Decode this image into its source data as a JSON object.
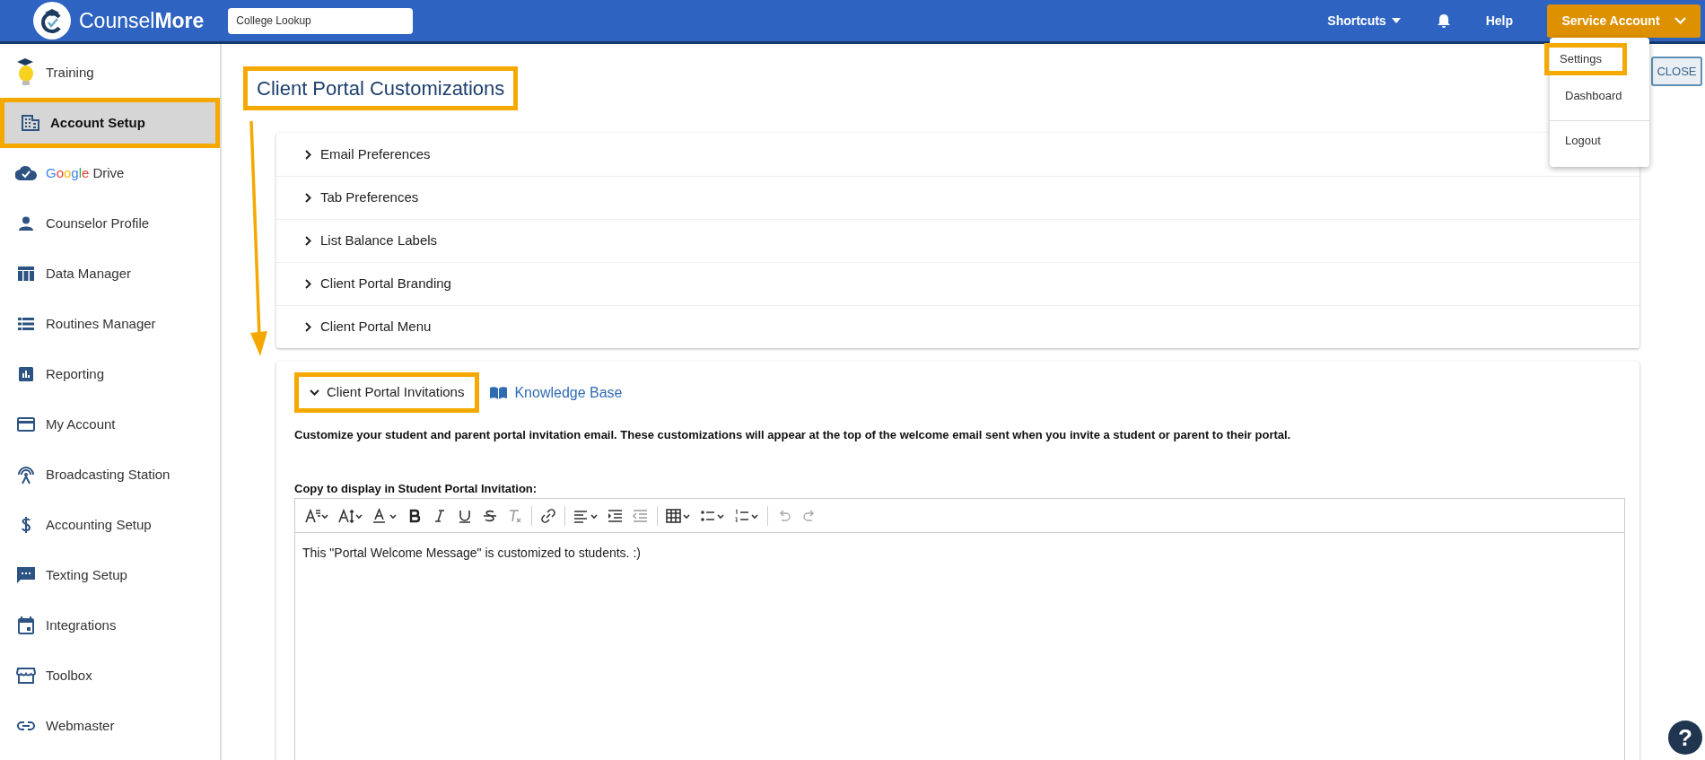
{
  "topbar": {
    "brand": "Counsel**More**",
    "search": {
      "value": "College Lookup"
    },
    "shortcuts": "Shortcuts",
    "help": "Help",
    "account": "Service Account"
  },
  "account_menu": [
    {
      "label": "Settings",
      "highlighted": true
    },
    {
      "label": "Dashboard",
      "highlighted": false
    },
    {
      "label": "Logout",
      "highlighted": false
    }
  ],
  "sidebar": {
    "items": [
      {
        "kind": "training",
        "label": "Training",
        "selected": false,
        "highlighted": false
      },
      {
        "kind": "building",
        "label": "Account Setup",
        "selected": true,
        "highlighted": true
      },
      {
        "kind": "cloud",
        "logo_text": "Google",
        "label": "Drive",
        "selected": false,
        "highlighted": false
      },
      {
        "kind": "person",
        "label": "Counselor Profile",
        "selected": false,
        "highlighted": false
      },
      {
        "kind": "table",
        "label": "Data Manager",
        "selected": false,
        "highlighted": false
      },
      {
        "kind": "list",
        "label": "Routines Manager",
        "selected": false,
        "highlighted": false
      },
      {
        "kind": "chart",
        "label": "Reporting",
        "selected": false,
        "highlighted": false
      },
      {
        "kind": "card",
        "label": "My Account",
        "selected": false,
        "highlighted": false
      },
      {
        "kind": "antenna",
        "label": "Broadcasting Station",
        "selected": false,
        "highlighted": false
      },
      {
        "kind": "dollar",
        "label": "Accounting Setup",
        "selected": false,
        "highlighted": false
      },
      {
        "kind": "chat",
        "label": "Texting Setup",
        "selected": false,
        "highlighted": false
      },
      {
        "kind": "calendar",
        "label": "Integrations",
        "selected": false,
        "highlighted": false
      },
      {
        "kind": "store",
        "label": "Toolbox",
        "selected": false,
        "highlighted": false
      },
      {
        "kind": "link",
        "label": "Webmaster",
        "selected": false,
        "highlighted": false
      }
    ]
  },
  "close_button": "CLOSE",
  "page_title": {
    "text": "Client Portal Customizations",
    "highlighted": true
  },
  "sections": [
    {
      "label": "Email Preferences",
      "expanded": false,
      "highlighted": false
    },
    {
      "label": "Tab Preferences",
      "expanded": false,
      "highlighted": false
    },
    {
      "label": "List Balance Labels",
      "expanded": false,
      "highlighted": false
    },
    {
      "label": "Client Portal Branding",
      "expanded": false,
      "highlighted": false
    },
    {
      "label": "Client Portal Menu",
      "expanded": false,
      "highlighted": false
    },
    {
      "label": "Client Portal Invitations",
      "expanded": true,
      "highlighted": true,
      "link": "Knowledge Base",
      "description": "Customize your student and parent portal invitation email. These customizations will appear at the top of the welcome email sent when you invite a student or parent to their portal.",
      "field_label": "Copy to display in Student Portal Invitation:",
      "editor_content": "This \"Portal Welcome Message\" is customized to students. :)"
    }
  ],
  "help_button": "?"
}
